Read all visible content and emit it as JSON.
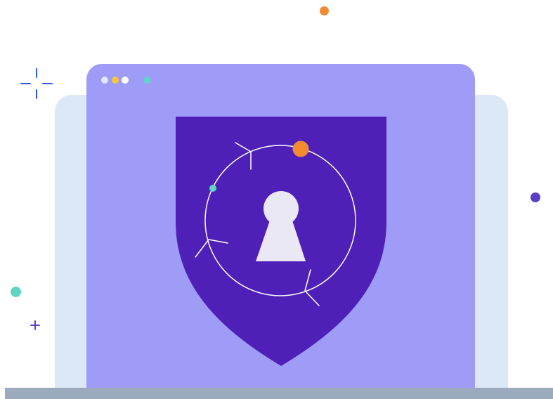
{
  "illustration": {
    "subject": "security-shield-keyhole",
    "icons": {
      "shield": "shield-icon",
      "keyhole": "keyhole-icon",
      "orbit": "orbit-ring-icon",
      "sparkle": "sparkle-icon",
      "plus": "plus-icon"
    },
    "colors": {
      "background": "#ffffff",
      "back_panel": "#dde8f6",
      "window": "#9f9cf8",
      "shield": "#4f20b8",
      "keyhole": "#ebe8f5",
      "orbit_line": "#ffffff",
      "accent_orange": "#f28a32",
      "accent_teal": "#5fd6c4",
      "accent_purple": "#5b3fc9",
      "accent_blue": "#2d5bd9",
      "floor": "#9caabd",
      "dot_light": "#dfe8ff",
      "dot_yellow": "#f6c73a",
      "dot_white": "#ffffff"
    }
  },
  "window": {
    "control_dots": [
      {
        "name": "light",
        "color": "#dfe8ff"
      },
      {
        "name": "yellow",
        "color": "#f6c73a"
      },
      {
        "name": "white",
        "color": "#ffffff"
      },
      {
        "name": "teal",
        "color": "#5fd6c4"
      }
    ]
  }
}
